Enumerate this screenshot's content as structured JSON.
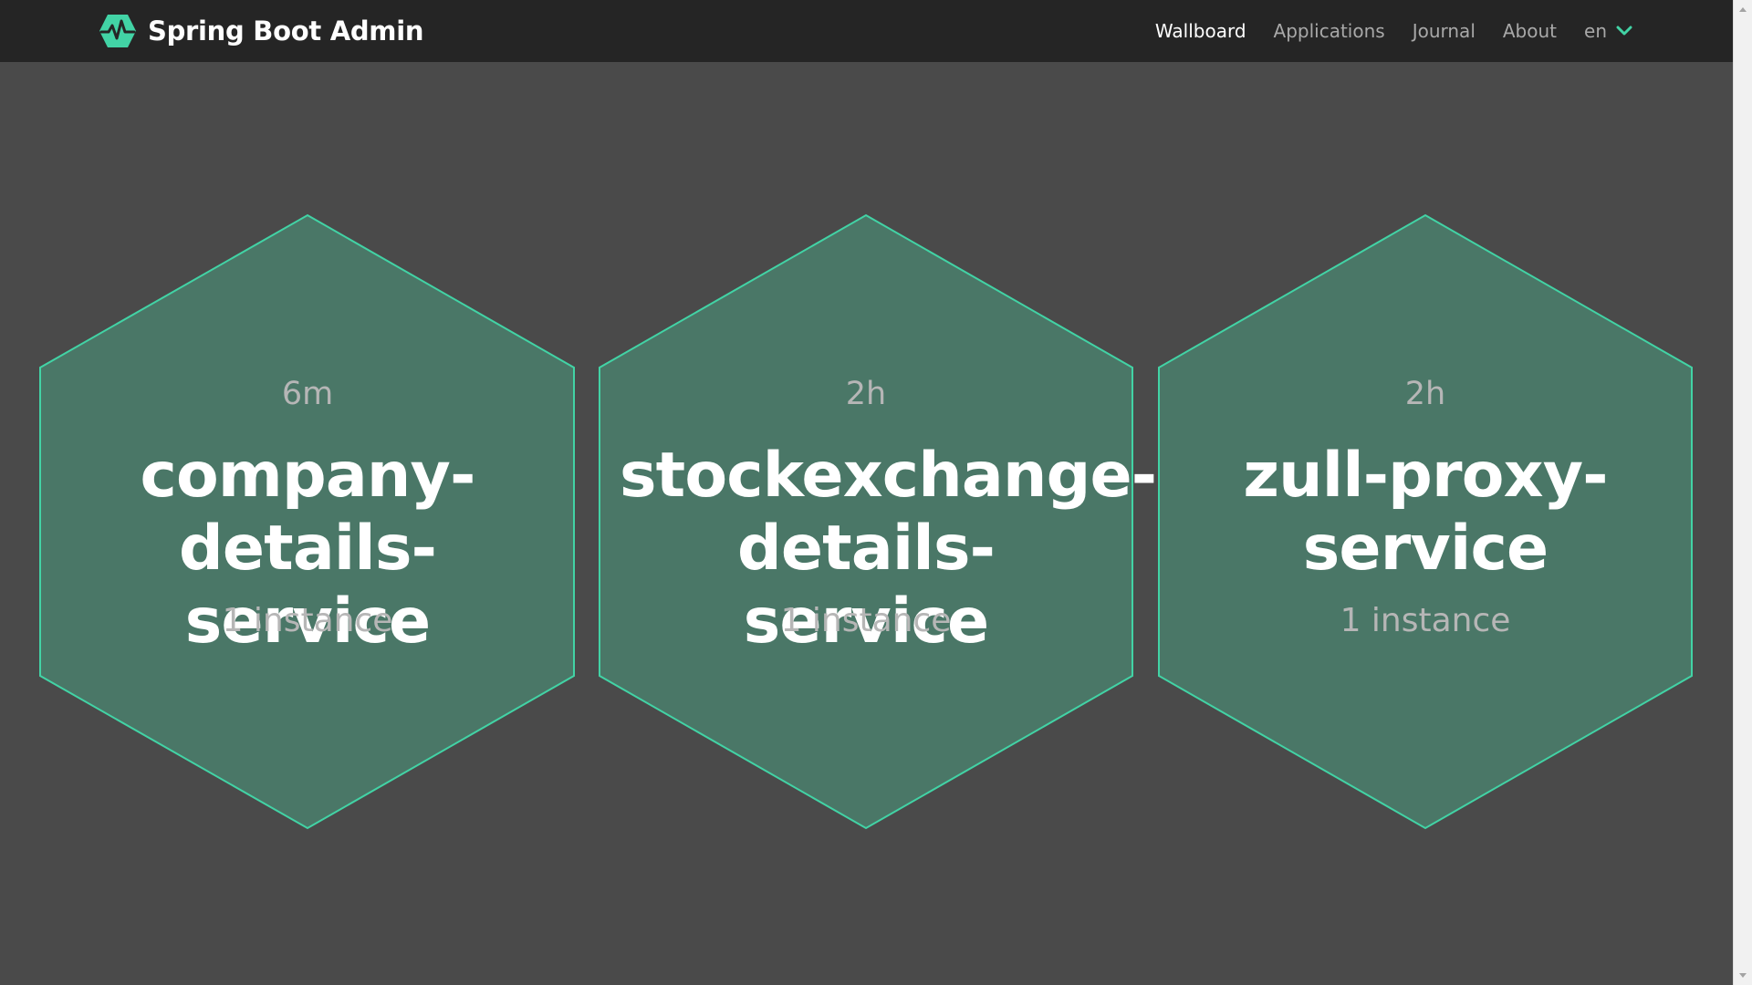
{
  "app": {
    "title": "Spring Boot Admin",
    "brand_icon": "heartbeat-hexagon-icon",
    "accent_color": "#42d3a5",
    "navbar_color": "#252525",
    "background_color": "#4a4a4a"
  },
  "nav": {
    "items": [
      {
        "label": "Wallboard",
        "active": true
      },
      {
        "label": "Applications",
        "active": false
      },
      {
        "label": "Journal",
        "active": false
      },
      {
        "label": "About",
        "active": false
      }
    ],
    "language": {
      "selected": "en",
      "icon": "chevron-down-icon"
    }
  },
  "wallboard": {
    "applications": [
      {
        "age": "6m",
        "name": "company-details-service",
        "name_lines": [
          "company-",
          "details-service"
        ],
        "instances": "1 instance",
        "status": "up",
        "fill_color": "#4a7767",
        "stroke_color": "#42d3a5"
      },
      {
        "age": "2h",
        "name": "stockexchange-details-service",
        "name_lines": [
          "stockexchange-",
          "details-service"
        ],
        "instances": "1 instance",
        "status": "up",
        "fill_color": "#4a7767",
        "stroke_color": "#42d3a5"
      },
      {
        "age": "2h",
        "name": "zull-proxy-service",
        "name_lines": [
          "zull-proxy-",
          "service"
        ],
        "instances": "1 instance",
        "status": "up",
        "fill_color": "#4a7767",
        "stroke_color": "#42d3a5"
      }
    ]
  }
}
